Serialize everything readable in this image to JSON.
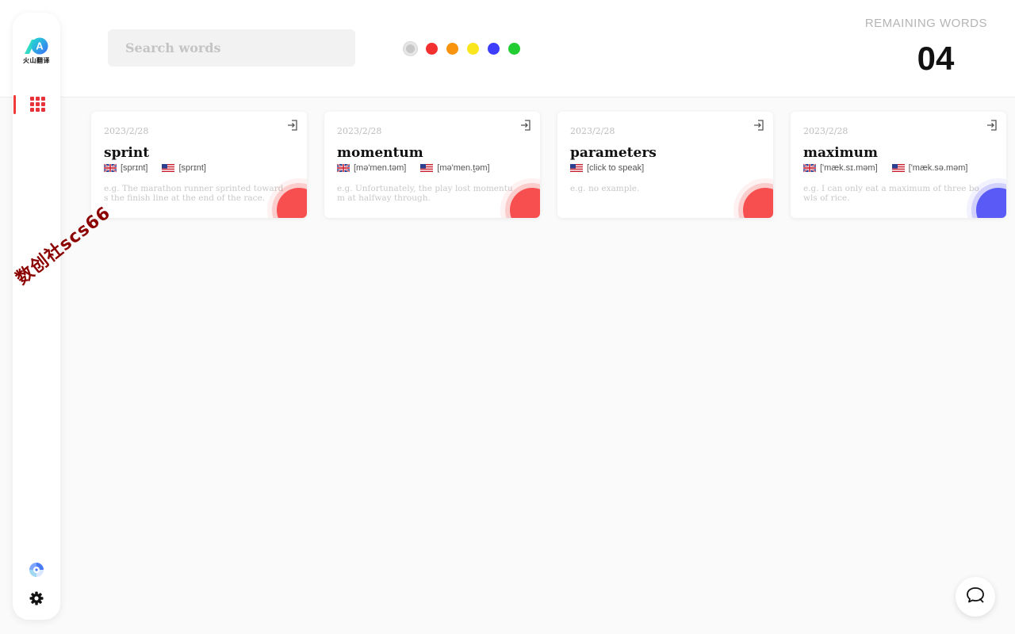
{
  "sidebar": {
    "logo_caption": "火山翻译",
    "logo_letter": "A",
    "nav_items": [
      {
        "icon": "grid-icon",
        "active": true
      }
    ],
    "bottom_icons": [
      "translate-app-icon",
      "gear-icon"
    ]
  },
  "header": {
    "search": {
      "placeholder": "Search words",
      "value": ""
    },
    "color_filters": [
      {
        "name": "all",
        "color": "#c7c7c7",
        "selected": true
      },
      {
        "name": "red",
        "color": "#f23030"
      },
      {
        "name": "orange",
        "color": "#f7930c"
      },
      {
        "name": "yellow",
        "color": "#f9e61d"
      },
      {
        "name": "blue",
        "color": "#3d3dfb"
      },
      {
        "name": "green",
        "color": "#22cc33"
      }
    ],
    "remaining": {
      "label": "REMAINING WORDS",
      "count": "04"
    }
  },
  "cards": [
    {
      "date": "2023/2/28",
      "word": "sprint",
      "uk": "[sprɪnt]",
      "us": "[sprɪnt]",
      "example": "e.g. The marathon runner sprinted towards the finish line at the end of the race.",
      "corner_color": "#f74f4f"
    },
    {
      "date": "2023/2/28",
      "word": "momentum",
      "uk": "[mə'men.təm]",
      "us": "[mə'men.t̬əm]",
      "example": "e.g. Unfortunately, the play lost momentum at halfway through.",
      "corner_color": "#f74f4f"
    },
    {
      "date": "2023/2/28",
      "word": "parameters",
      "us": "[click to speak]",
      "example": "e.g. no example.",
      "corner_color": "#f74f4f"
    },
    {
      "date": "2023/2/28",
      "word": "maximum",
      "uk": "['mæk.sɪ.məm]",
      "us": "['mæk.sə.məm]",
      "example": "e.g. I can only eat a maximum of three bowls of rice.",
      "corner_color": "#5a5af7"
    }
  ],
  "watermark": "数创社scs66"
}
